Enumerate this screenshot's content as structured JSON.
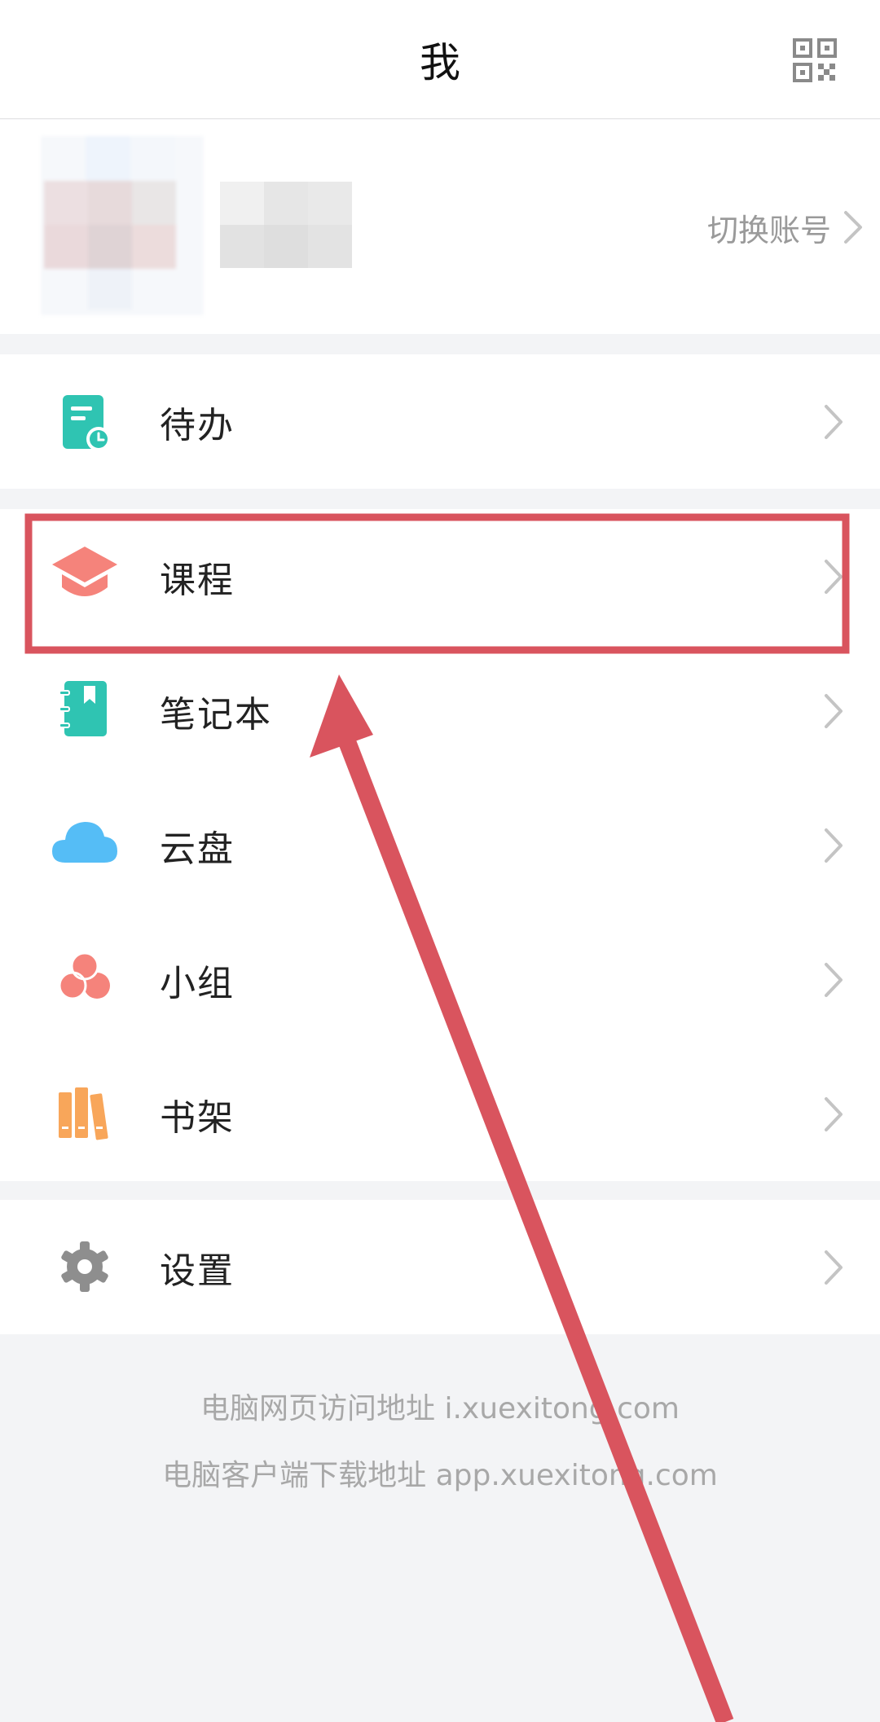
{
  "header": {
    "title": "我"
  },
  "profile": {
    "switch_account": "切换账号"
  },
  "groups": {
    "todo": {
      "label": "待办"
    },
    "main": {
      "course": {
        "label": "课程"
      },
      "notebook": {
        "label": "笔记本"
      },
      "cloud": {
        "label": "云盘"
      },
      "group": {
        "label": "小组"
      },
      "bookshelf": {
        "label": "书架"
      }
    },
    "settings": {
      "label": "设置"
    }
  },
  "footer": {
    "web_address": "电脑网页访问地址 i.xuexitong.com",
    "client_download": "电脑客户端下载地址 app.xuexitong.com"
  },
  "colors": {
    "teal": "#2fc4b2",
    "coral": "#f5837b",
    "sky": "#55bdf6",
    "orange": "#f8a65a",
    "gray_icon": "#8e8e8e",
    "annotation_red": "#d9545e"
  }
}
